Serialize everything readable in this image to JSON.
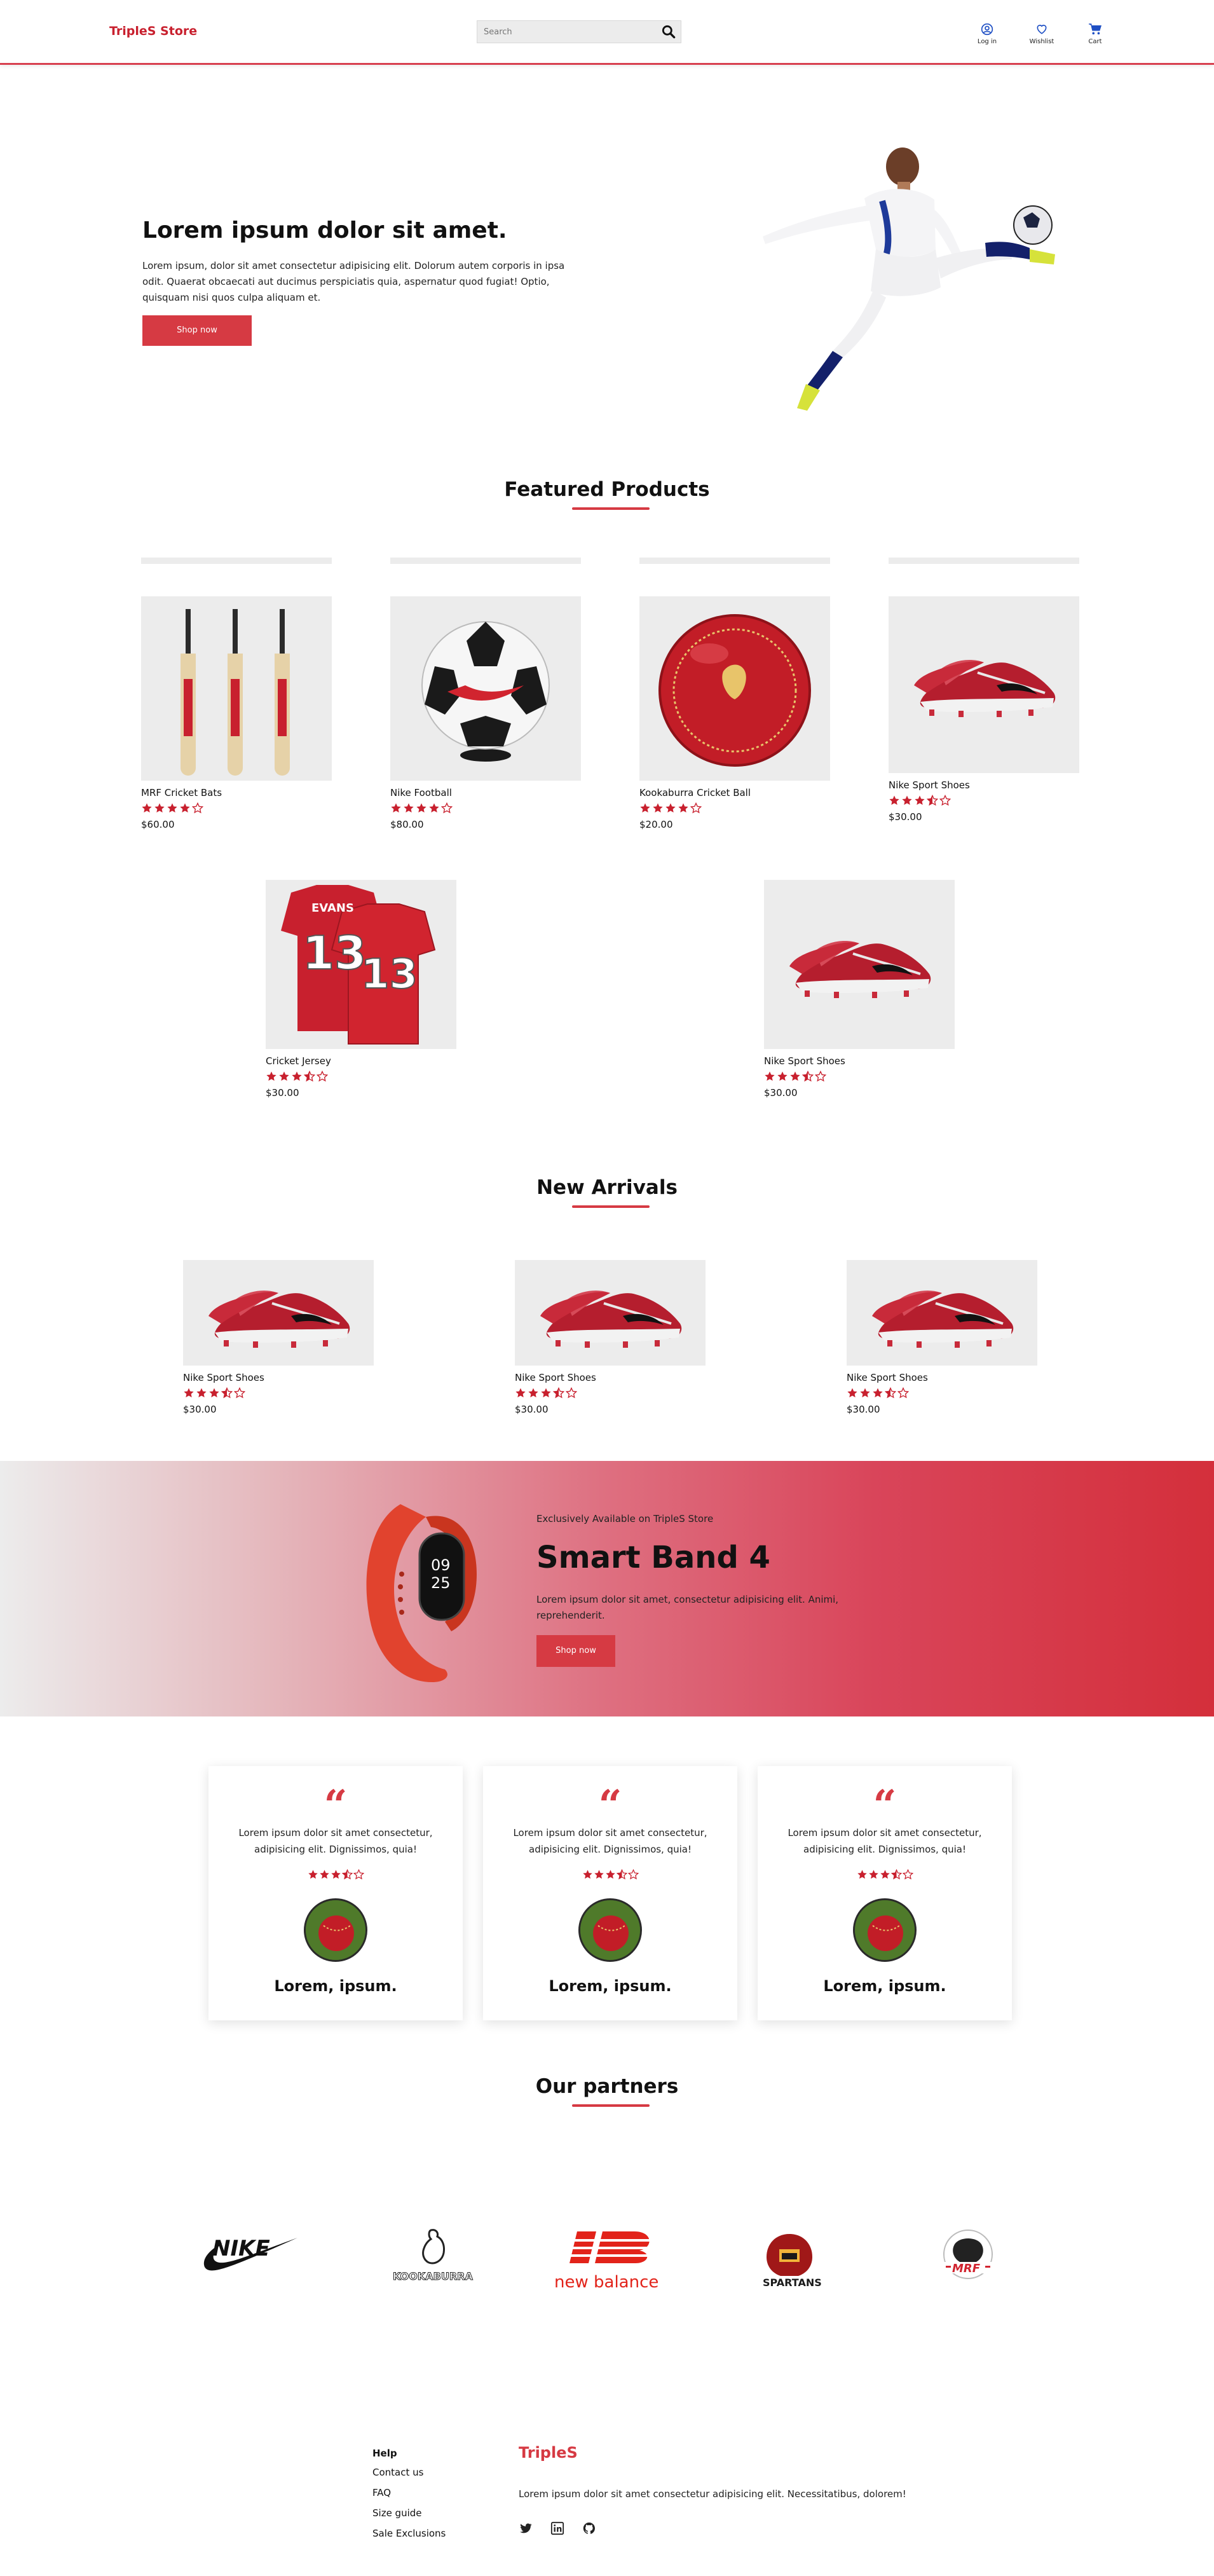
{
  "header": {
    "brand": "TripleS Store",
    "search_placeholder": "Search",
    "nav": [
      {
        "label": "Log in",
        "icon": "user-circle-icon"
      },
      {
        "label": "Wishlist",
        "icon": "heart-icon"
      },
      {
        "label": "Cart",
        "icon": "cart-icon"
      }
    ]
  },
  "hero": {
    "title": "Lorem ipsum dolor sit amet.",
    "text": "Lorem ipsum, dolor sit amet consectetur adipisicing elit. Dolorum autem corporis in ipsa odit. Quaerat obcaecati aut ducimus perspiciatis quia, aspernatur quod fugiat! Optio, quisquam nisi quos culpa aliquam et.",
    "button": "Shop now",
    "image": "footballer-kicking-ball-image"
  },
  "featured": {
    "title": "Featured Products",
    "products": [
      {
        "name": "MRF Cricket Bats",
        "rating": 4,
        "price": "$60.00",
        "image": "cricket-bats-image"
      },
      {
        "name": "Nike Football",
        "rating": 4,
        "price": "$80.00",
        "image": "football-image"
      },
      {
        "name": "Kookaburra Cricket Ball",
        "rating": 4,
        "price": "$20.00",
        "image": "cricket-ball-image"
      },
      {
        "name": "Nike Sport Shoes",
        "rating": 3.5,
        "price": "$30.00",
        "image": "red-shoes-image"
      },
      {
        "name": "Cricket Jersey",
        "rating": 3.5,
        "price": "$30.00",
        "image": "jersey-image"
      },
      {
        "name": "Nike Sport Shoes",
        "rating": 3.5,
        "price": "$30.00",
        "image": "red-shoes-image"
      }
    ]
  },
  "arrivals": {
    "title": "New Arrivals",
    "products": [
      {
        "name": "Nike Sport Shoes",
        "rating": 3.5,
        "price": "$30.00"
      },
      {
        "name": "Nike Sport Shoes",
        "rating": 3.5,
        "price": "$30.00"
      },
      {
        "name": "Nike Sport Shoes",
        "rating": 3.5,
        "price": "$30.00"
      }
    ]
  },
  "banner": {
    "kicker": "Exclusively Available on TripleS Store",
    "title": "Smart Band 4",
    "text": "Lorem ipsum dolor sit amet, consectetur adipisicing elit. Animi, reprehenderit.",
    "button": "Shop now",
    "watch_time_hour": "09",
    "watch_time_min": "25",
    "image": "smart-band-image"
  },
  "testimonials": [
    {
      "text": "Lorem ipsum dolor sit amet consectetur, adipisicing elit. Dignissimos, quia!",
      "rating": 3.5,
      "name": "Lorem, ipsum."
    },
    {
      "text": "Lorem ipsum dolor sit amet consectetur, adipisicing elit. Dignissimos, quia!",
      "rating": 3.5,
      "name": "Lorem, ipsum."
    },
    {
      "text": "Lorem ipsum dolor sit amet consectetur, adipisicing elit. Dignissimos, quia!",
      "rating": 3.5,
      "name": "Lorem, ipsum."
    }
  ],
  "partners": {
    "title": "Our partners",
    "logos": [
      {
        "name": "nike-logo",
        "text": ""
      },
      {
        "name": "kookaburra-logo",
        "text": "KOOKABURRA"
      },
      {
        "name": "new-balance-logo",
        "text": "new balance"
      },
      {
        "name": "spartans-logo",
        "text": "SPARTANS"
      },
      {
        "name": "mrf-logo",
        "text": "MRF"
      }
    ]
  },
  "footer": {
    "help_title": "Help",
    "links": [
      "Contact us",
      "FAQ",
      "Size guide",
      "Sale Exclusions"
    ],
    "brand": "TripleS",
    "text": "Lorem ipsum dolor sit amet consectetur adipisicing elit. Necessitatibus, dolorem!",
    "social": [
      "twitter-icon",
      "linkedin-icon",
      "github-icon"
    ]
  },
  "colors": {
    "accent": "#d63a43",
    "brand": "#c8202e",
    "star": "#c8202e",
    "image_bg": "#ececec"
  }
}
